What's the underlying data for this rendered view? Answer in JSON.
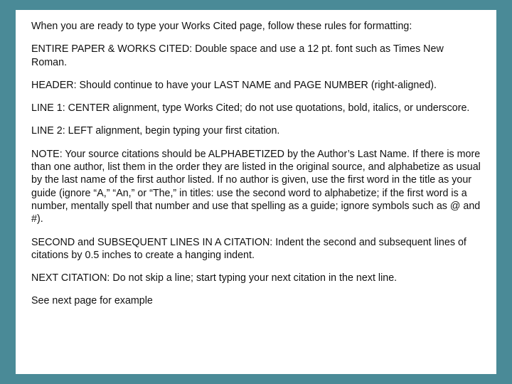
{
  "slide": {
    "p1": "When you are ready to type your Works Cited page, follow these rules for formatting:",
    "p2": "ENTIRE PAPER & WORKS CITED: Double space and use a 12 pt. font such as Times New Roman.",
    "p3": "HEADER: Should continue to have your LAST NAME and PAGE NUMBER (right-aligned).",
    "p4": "LINE 1: CENTER alignment, type Works Cited; do not use quotations, bold, italics, or underscore.",
    "p5": "LINE 2: LEFT alignment, begin typing your first citation.",
    "p6": "NOTE: Your source citations should be ALPHABETIZED by the Author’s Last Name. If there is more than one author, list them in the order they are listed in the original source, and alphabetize as usual by the last name of the first author listed. If no author is given, use the first word in the title as your guide (ignore “A,” “An,” or “The,” in titles: use the second word to alphabetize; if the first word is a number, mentally spell that number and use that spelling as a guide; ignore symbols such as @ and #).",
    "p7": "SECOND and SUBSEQUENT LINES IN A CITATION: Indent the second and subsequent lines of citations by 0.5 inches to create a hanging indent.",
    "p8": "NEXT CITATION: Do not skip a line; start typing your next citation in the next line.",
    "p9": "See next page for example"
  }
}
